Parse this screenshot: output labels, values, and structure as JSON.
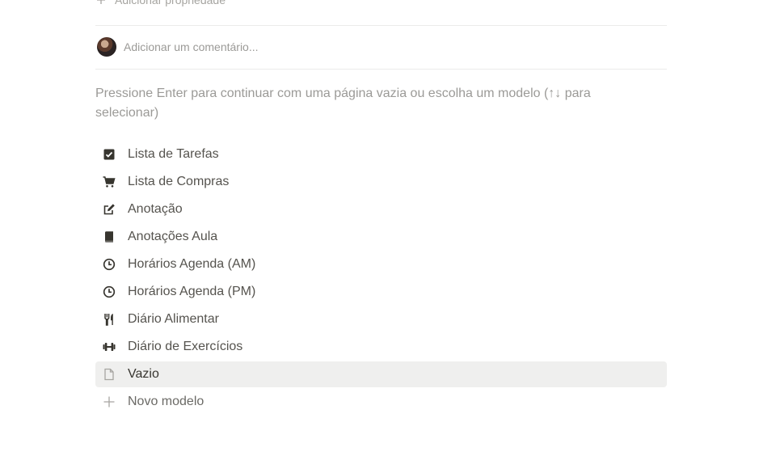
{
  "property_row": {
    "label": "Adicionar propriedade",
    "icon": "plus-icon"
  },
  "comment": {
    "placeholder": "Adicionar um comentário..."
  },
  "hint": {
    "text": "Pressione Enter para continuar com uma página vazia ou escolha um modelo (↑↓ para selecionar)"
  },
  "templates": [
    {
      "label": "Lista de Tarefas",
      "icon": "checkbox-icon"
    },
    {
      "label": "Lista de Compras",
      "icon": "shopping-cart-icon"
    },
    {
      "label": "Anotação",
      "icon": "edit-note-icon"
    },
    {
      "label": "Anotações Aula",
      "icon": "book-icon"
    },
    {
      "label": "Horários Agenda (AM)",
      "icon": "clock-icon"
    },
    {
      "label": "Horários Agenda (PM)",
      "icon": "clock-icon"
    },
    {
      "label": "Diário Alimentar",
      "icon": "fork-knife-icon"
    },
    {
      "label": "Diário de Exercícios",
      "icon": "dumbbell-icon"
    },
    {
      "label": "Vazio",
      "icon": "blank-page-icon",
      "selected": true
    },
    {
      "label": "Novo modelo",
      "icon": "plus-icon"
    }
  ],
  "colors": {
    "text": "#37352f",
    "muted": "#9b9a97",
    "hover_bg": "#efefee",
    "divider": "#ebebea"
  }
}
